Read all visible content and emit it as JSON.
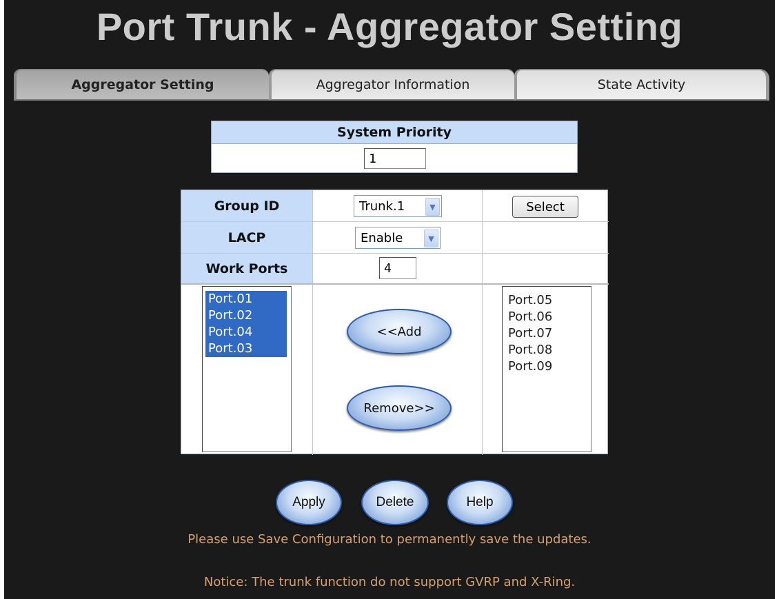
{
  "title": "Port Trunk - Aggregator Setting",
  "tabs": [
    {
      "label": "Aggregator Setting",
      "active": true
    },
    {
      "label": "Aggregator Information",
      "active": false
    },
    {
      "label": "State Activity",
      "active": false
    }
  ],
  "system_priority": {
    "label": "System Priority",
    "value": "1"
  },
  "group_id": {
    "label": "Group ID",
    "selected": "Trunk.1",
    "button": "Select"
  },
  "lacp": {
    "label": "LACP",
    "selected": "Enable"
  },
  "work_ports": {
    "label": "Work Ports",
    "value": "4"
  },
  "member_ports": [
    "Port.01",
    "Port.02",
    "Port.04",
    "Port.03"
  ],
  "available_ports": [
    "Port.05",
    "Port.06",
    "Port.07",
    "Port.08",
    "Port.09"
  ],
  "move_buttons": {
    "add": "<<Add",
    "remove": "Remove>>"
  },
  "actions": {
    "apply": "Apply",
    "delete": "Delete",
    "help": "Help"
  },
  "notes": {
    "save": "Please use Save Configuration to permanently save the updates.",
    "notice": "Notice: The trunk function do not support GVRP and X-Ring."
  },
  "icons": {
    "dropdown": "chevron-down-icon"
  },
  "colors": {
    "background": "#1a1a1a",
    "header_cell": "#c6dcf8",
    "selection": "#316ac5",
    "note_text": "#d8a070"
  }
}
